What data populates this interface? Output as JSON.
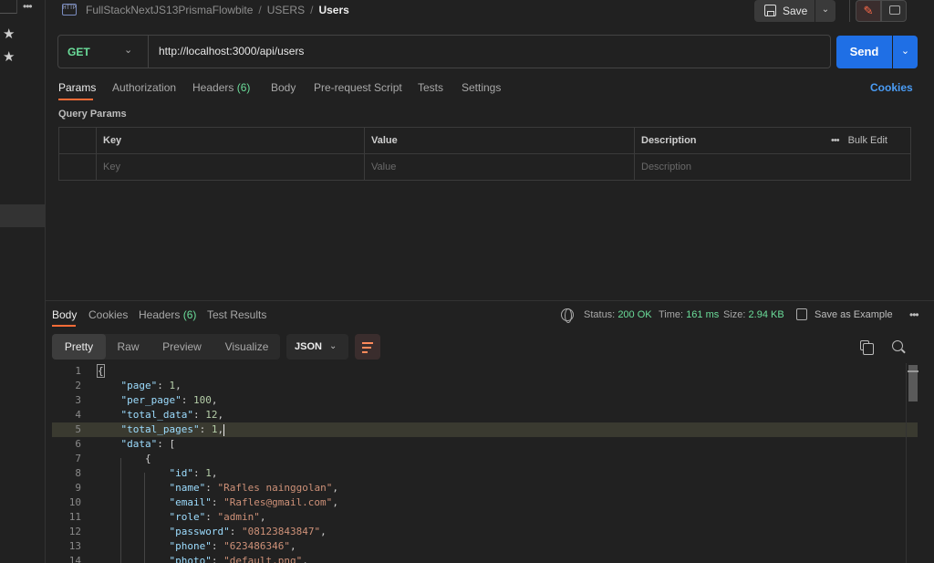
{
  "sidebar": {
    "more_icon": "more-horizontal-icon",
    "stars": [
      "★",
      "★"
    ]
  },
  "header": {
    "collection": "FullStackNextJS13PrismaFlowbite",
    "folder": "USERS",
    "request_name": "Users",
    "separator": "/",
    "http_icon_label": "HTTP",
    "save_label": "Save"
  },
  "request": {
    "method": "GET",
    "url": "http://localhost:3000/api/users",
    "send_label": "Send",
    "method_color": "#6bdd9a",
    "send_color": "#1f6fe5"
  },
  "request_tabs": {
    "params": "Params",
    "authorization": "Authorization",
    "headers": "Headers",
    "headers_count": "(6)",
    "body": "Body",
    "prerequest": "Pre-request Script",
    "tests": "Tests",
    "settings": "Settings",
    "cookies": "Cookies"
  },
  "query_params": {
    "title": "Query Params",
    "headers": {
      "key": "Key",
      "value": "Value",
      "description": "Description",
      "bulk_edit": "Bulk Edit"
    },
    "placeholders": {
      "key": "Key",
      "value": "Value",
      "description": "Description"
    }
  },
  "response_tabs": {
    "body": "Body",
    "cookies": "Cookies",
    "headers": "Headers",
    "headers_count": "(6)",
    "test_results": "Test Results"
  },
  "response_meta": {
    "status_label": "Status:",
    "status_value": "200 OK",
    "time_label": "Time:",
    "time_value": "161 ms",
    "size_label": "Size:",
    "size_value": "2.94 KB",
    "save_example": "Save as Example"
  },
  "format_bar": {
    "pretty": "Pretty",
    "raw": "Raw",
    "preview": "Preview",
    "visualize": "Visualize",
    "format": "JSON"
  },
  "code": {
    "highlighted_line": 5,
    "lines": [
      {
        "n": "1",
        "indent": "",
        "tokens": [
          [
            "brace",
            "{"
          ]
        ]
      },
      {
        "n": "2",
        "indent": "    ",
        "tokens": [
          [
            "key",
            "\"page\""
          ],
          [
            "p",
            ": "
          ],
          [
            "num",
            "1"
          ],
          [
            "p",
            ","
          ]
        ]
      },
      {
        "n": "3",
        "indent": "    ",
        "tokens": [
          [
            "key",
            "\"per_page\""
          ],
          [
            "p",
            ": "
          ],
          [
            "num",
            "100"
          ],
          [
            "p",
            ","
          ]
        ]
      },
      {
        "n": "4",
        "indent": "    ",
        "tokens": [
          [
            "key",
            "\"total_data\""
          ],
          [
            "p",
            ": "
          ],
          [
            "num",
            "12"
          ],
          [
            "p",
            ","
          ]
        ]
      },
      {
        "n": "5",
        "indent": "    ",
        "tokens": [
          [
            "key",
            "\"total_pages\""
          ],
          [
            "p",
            ": "
          ],
          [
            "num",
            "1"
          ],
          [
            "p",
            ","
          ],
          [
            "cursor",
            ""
          ]
        ]
      },
      {
        "n": "6",
        "indent": "    ",
        "tokens": [
          [
            "key",
            "\"data\""
          ],
          [
            "p",
            ": ["
          ]
        ]
      },
      {
        "n": "7",
        "indent": "        ",
        "tokens": [
          [
            "p",
            "{"
          ]
        ]
      },
      {
        "n": "8",
        "indent": "            ",
        "tokens": [
          [
            "key",
            "\"id\""
          ],
          [
            "p",
            ": "
          ],
          [
            "num",
            "1"
          ],
          [
            "p",
            ","
          ]
        ]
      },
      {
        "n": "9",
        "indent": "            ",
        "tokens": [
          [
            "key",
            "\"name\""
          ],
          [
            "p",
            ": "
          ],
          [
            "str",
            "\"Rafles nainggolan\""
          ],
          [
            "p",
            ","
          ]
        ]
      },
      {
        "n": "10",
        "indent": "            ",
        "tokens": [
          [
            "key",
            "\"email\""
          ],
          [
            "p",
            ": "
          ],
          [
            "str",
            "\"Rafles@gmail.com\""
          ],
          [
            "p",
            ","
          ]
        ]
      },
      {
        "n": "11",
        "indent": "            ",
        "tokens": [
          [
            "key",
            "\"role\""
          ],
          [
            "p",
            ": "
          ],
          [
            "str",
            "\"admin\""
          ],
          [
            "p",
            ","
          ]
        ]
      },
      {
        "n": "12",
        "indent": "            ",
        "tokens": [
          [
            "key",
            "\"password\""
          ],
          [
            "p",
            ": "
          ],
          [
            "str",
            "\"08123843847\""
          ],
          [
            "p",
            ","
          ]
        ]
      },
      {
        "n": "13",
        "indent": "            ",
        "tokens": [
          [
            "key",
            "\"phone\""
          ],
          [
            "p",
            ": "
          ],
          [
            "str",
            "\"623486346\""
          ],
          [
            "p",
            ","
          ]
        ]
      },
      {
        "n": "14",
        "indent": "            ",
        "tokens": [
          [
            "key",
            "\"photo\""
          ],
          [
            "p",
            ": "
          ],
          [
            "str",
            "\"default.png\""
          ],
          [
            "p",
            ","
          ]
        ]
      }
    ]
  }
}
